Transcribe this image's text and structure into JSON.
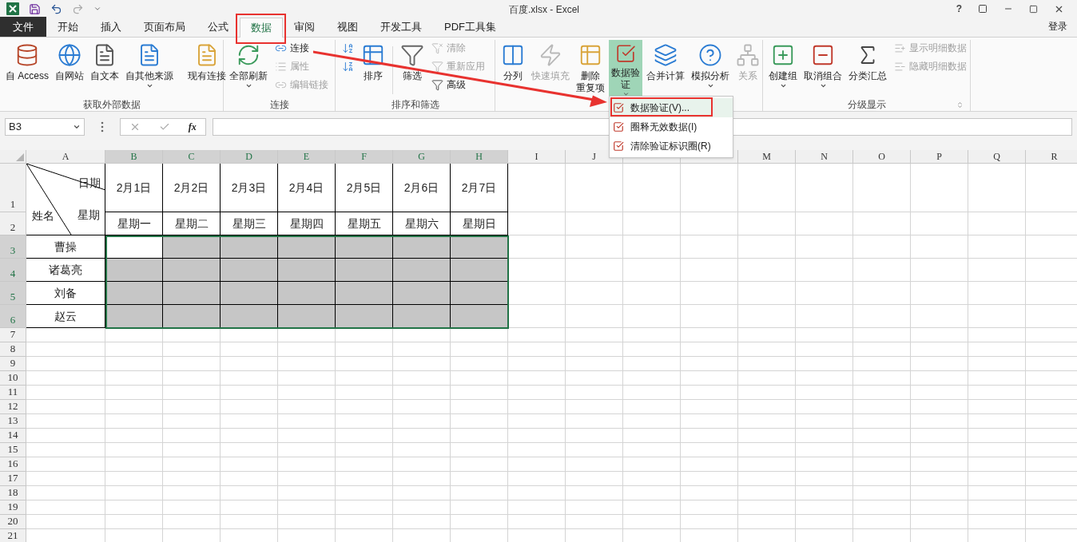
{
  "window": {
    "title": "百度.xlsx - Excel",
    "help": "?"
  },
  "tabs": [
    {
      "label": "文件",
      "kind": "file",
      "selected": false
    },
    {
      "label": "开始",
      "kind": "tab",
      "selected": false
    },
    {
      "label": "插入",
      "kind": "tab",
      "selected": false
    },
    {
      "label": "页面布局",
      "kind": "tab",
      "selected": false
    },
    {
      "label": "公式",
      "kind": "tab",
      "selected": false
    },
    {
      "label": "数据",
      "kind": "tab",
      "selected": true
    },
    {
      "label": "审阅",
      "kind": "tab",
      "selected": false
    },
    {
      "label": "视图",
      "kind": "tab",
      "selected": false
    },
    {
      "label": "开发工具",
      "kind": "tab",
      "selected": false
    },
    {
      "label": "PDF工具集",
      "kind": "tab",
      "selected": false
    }
  ],
  "account": "登录",
  "ribbon_groups": [
    {
      "label": "获取外部数据",
      "buttons": [
        {
          "kind": "large",
          "lines": [
            "自 Access"
          ],
          "disabled": false,
          "dropdown": false,
          "selected": false
        },
        {
          "kind": "large",
          "lines": [
            "自网站"
          ],
          "disabled": false,
          "dropdown": false,
          "selected": false
        },
        {
          "kind": "large",
          "lines": [
            "自文本"
          ],
          "disabled": false,
          "dropdown": false,
          "selected": false
        },
        {
          "kind": "large",
          "lines": [
            "自其他来源"
          ],
          "disabled": false,
          "dropdown": true,
          "selected": false
        },
        {
          "kind": "separator"
        },
        {
          "kind": "large",
          "lines": [
            "现有连接"
          ],
          "disabled": false,
          "dropdown": false,
          "selected": false
        }
      ]
    },
    {
      "label": "连接",
      "buttons": [
        {
          "kind": "large",
          "lines": [
            "全部刷新"
          ],
          "disabled": false,
          "dropdown": true,
          "selected": false
        },
        {
          "kind": "stack",
          "items": [
            {
              "label": "连接",
              "disabled": false
            },
            {
              "label": "属性",
              "disabled": true
            },
            {
              "label": "编辑链接",
              "disabled": true
            }
          ]
        }
      ]
    },
    {
      "label": "排序和筛选",
      "buttons": [
        {
          "kind": "stack",
          "items": [
            {
              "disabled": false
            },
            {
              "disabled": false
            }
          ]
        },
        {
          "kind": "large",
          "lines": [
            "排序"
          ],
          "disabled": false,
          "dropdown": false,
          "selected": false
        },
        {
          "kind": "separator"
        },
        {
          "kind": "large",
          "lines": [
            "筛选"
          ],
          "disabled": false,
          "dropdown": false,
          "selected": false
        },
        {
          "kind": "stack",
          "items": [
            {
              "label": "清除",
              "disabled": true
            },
            {
              "label": "重新应用",
              "disabled": true
            },
            {
              "label": "高级",
              "disabled": false
            }
          ]
        }
      ]
    },
    {
      "buttons": [
        {
          "kind": "large",
          "lines": [
            "分列"
          ],
          "disabled": false,
          "dropdown": false,
          "selected": false
        },
        {
          "kind": "large",
          "lines": [
            "快速填充"
          ],
          "disabled": true,
          "dropdown": false,
          "selected": false
        },
        {
          "kind": "large",
          "lines": [
            "删除",
            "重复项"
          ],
          "disabled": false,
          "dropdown": false,
          "selected": false
        },
        {
          "kind": "large",
          "lines": [
            "数据验",
            "证"
          ],
          "disabled": false,
          "dropdown": true,
          "selected": true
        },
        {
          "kind": "large",
          "lines": [
            "合并计算"
          ],
          "disabled": false,
          "dropdown": false,
          "selected": false
        },
        {
          "kind": "large",
          "lines": [
            "模拟分析"
          ],
          "disabled": false,
          "dropdown": true,
          "selected": false
        },
        {
          "kind": "large",
          "lines": [
            "关系"
          ],
          "disabled": true,
          "dropdown": false,
          "selected": false
        }
      ]
    },
    {
      "label": "分级显示",
      "launcher": true,
      "buttons": [
        {
          "kind": "large",
          "lines": [
            "创建组"
          ],
          "disabled": false,
          "dropdown": true,
          "selected": false
        },
        {
          "kind": "large",
          "lines": [
            "取消组合"
          ],
          "disabled": false,
          "dropdown": true,
          "selected": false
        },
        {
          "kind": "large",
          "lines": [
            "分类汇总"
          ],
          "disabled": false,
          "dropdown": false,
          "selected": false
        },
        {
          "kind": "stack",
          "items": [
            {
              "label": "显示明细数据",
              "disabled": true
            },
            {
              "label": "隐藏明细数据",
              "disabled": true
            }
          ]
        }
      ]
    }
  ],
  "menu": {
    "items": [
      {
        "label": "数据验证(V)...",
        "highlighted": true
      },
      {
        "label": "圈释无效数据(I)",
        "highlighted": false
      },
      {
        "label": "清除验证标识圈(R)",
        "highlighted": false
      }
    ]
  },
  "formula_bar": {
    "name_box": "B3",
    "function_label": "fx"
  },
  "sheet": {
    "columns": [
      {
        "label": "A",
        "selected": false
      },
      {
        "label": "B",
        "selected": true
      },
      {
        "label": "C",
        "selected": true
      },
      {
        "label": "D",
        "selected": true
      },
      {
        "label": "E",
        "selected": true
      },
      {
        "label": "F",
        "selected": true
      },
      {
        "label": "G",
        "selected": true
      },
      {
        "label": "H",
        "selected": true
      },
      {
        "label": "I",
        "selected": false
      },
      {
        "label": "J",
        "selected": false
      },
      {
        "selected": false
      },
      {
        "selected": false
      },
      {
        "label": "M",
        "selected": false
      },
      {
        "label": "N",
        "selected": false
      },
      {
        "label": "O",
        "selected": false
      },
      {
        "label": "P",
        "selected": false
      },
      {
        "label": "Q",
        "selected": false
      },
      {
        "label": "R",
        "selected": false
      }
    ],
    "corner_header": {
      "row_numbers": [
        "1",
        "2"
      ],
      "top_right": "日期",
      "bottom_right": "星期",
      "bottom_left": "姓名"
    },
    "dates": [
      "2月1日",
      "2月2日",
      "2月3日",
      "2月4日",
      "2月5日",
      "2月6日",
      "2月7日"
    ],
    "weekdays": [
      "星期一",
      "星期二",
      "星期三",
      "星期四",
      "星期五",
      "星期六",
      "星期日"
    ],
    "rows": [
      {
        "number": "3",
        "selected": true,
        "name": "曹操",
        "cells": [
          {
            "active": true
          },
          {
            "active": false
          },
          {
            "active": false
          },
          {
            "active": false
          },
          {
            "active": false
          },
          {
            "active": false
          },
          {
            "active": false
          }
        ]
      },
      {
        "number": "4",
        "selected": true,
        "name": "诸葛亮",
        "cells": [
          {
            "active": false
          },
          {
            "active": false
          },
          {
            "active": false
          },
          {
            "active": false
          },
          {
            "active": false
          },
          {
            "active": false
          },
          {
            "active": false
          }
        ]
      },
      {
        "number": "5",
        "selected": true,
        "name": "刘备",
        "cells": [
          {
            "active": false
          },
          {
            "active": false
          },
          {
            "active": false
          },
          {
            "active": false
          },
          {
            "active": false
          },
          {
            "active": false
          },
          {
            "active": false
          }
        ]
      },
      {
        "number": "6",
        "selected": true,
        "name": "赵云",
        "cells": [
          {
            "active": false
          },
          {
            "active": false
          },
          {
            "active": false
          },
          {
            "active": false
          },
          {
            "active": false
          },
          {
            "active": false
          },
          {
            "active": false
          }
        ]
      }
    ],
    "empty_rows": [
      "7",
      "8",
      "9",
      "10",
      "11",
      "12",
      "13",
      "14",
      "15",
      "16",
      "17",
      "18",
      "19",
      "20",
      "21"
    ]
  }
}
